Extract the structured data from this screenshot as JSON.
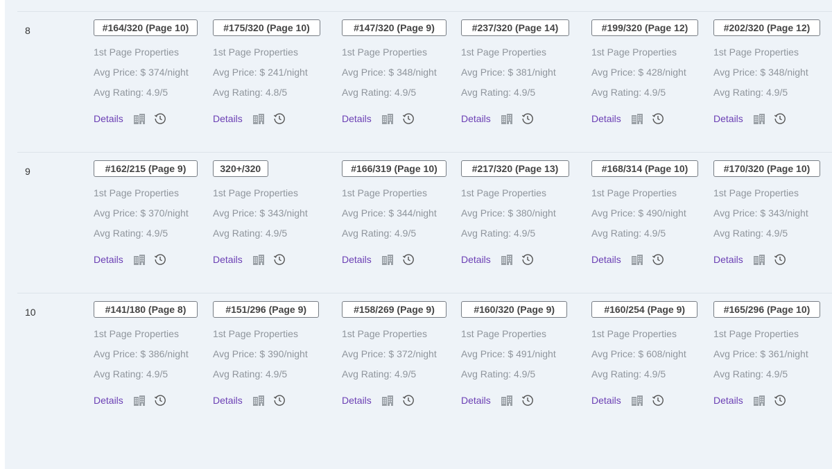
{
  "rows": [
    {
      "num": "8",
      "cells": [
        {
          "rank": "#164/320 (Page 10)",
          "properties": "1st Page Properties",
          "price": "Avg Price: $ 374/night",
          "rating": "Avg Rating: 4.9/5",
          "details": "Details"
        },
        {
          "rank": "#175/320 (Page 10)",
          "properties": "1st Page Properties",
          "price": "Avg Price: $ 241/night",
          "rating": "Avg Rating: 4.8/5",
          "details": "Details"
        },
        {
          "rank": "#147/320 (Page 9)",
          "properties": "1st Page Properties",
          "price": "Avg Price: $ 348/night",
          "rating": "Avg Rating: 4.9/5",
          "details": "Details"
        },
        {
          "rank": "#237/320 (Page 14)",
          "properties": "1st Page Properties",
          "price": "Avg Price: $ 381/night",
          "rating": "Avg Rating: 4.9/5",
          "details": "Details"
        },
        {
          "rank": "#199/320 (Page 12)",
          "properties": "1st Page Properties",
          "price": "Avg Price: $ 428/night",
          "rating": "Avg Rating: 4.9/5",
          "details": "Details"
        },
        {
          "rank": "#202/320 (Page 12)",
          "properties": "1st Page Properties",
          "price": "Avg Price: $ 348/night",
          "rating": "Avg Rating: 4.9/5",
          "details": "Details"
        }
      ]
    },
    {
      "num": "9",
      "cells": [
        {
          "rank": "#162/215 (Page 9)",
          "properties": "1st Page Properties",
          "price": "Avg Price: $ 370/night",
          "rating": "Avg Rating: 4.9/5",
          "details": "Details"
        },
        {
          "rank": "320+/320",
          "properties": "1st Page Properties",
          "price": "Avg Price: $ 343/night",
          "rating": "Avg Rating: 4.9/5",
          "details": "Details"
        },
        {
          "rank": "#166/319 (Page 10)",
          "properties": "1st Page Properties",
          "price": "Avg Price: $ 344/night",
          "rating": "Avg Rating: 4.9/5",
          "details": "Details"
        },
        {
          "rank": "#217/320 (Page 13)",
          "properties": "1st Page Properties",
          "price": "Avg Price: $ 380/night",
          "rating": "Avg Rating: 4.9/5",
          "details": "Details"
        },
        {
          "rank": "#168/314 (Page 10)",
          "properties": "1st Page Properties",
          "price": "Avg Price: $ 490/night",
          "rating": "Avg Rating: 4.9/5",
          "details": "Details"
        },
        {
          "rank": "#170/320 (Page 10)",
          "properties": "1st Page Properties",
          "price": "Avg Price: $ 343/night",
          "rating": "Avg Rating: 4.9/5",
          "details": "Details"
        }
      ]
    },
    {
      "num": "10",
      "cells": [
        {
          "rank": "#141/180 (Page 8)",
          "properties": "1st Page Properties",
          "price": "Avg Price: $ 386/night",
          "rating": "Avg Rating: 4.9/5",
          "details": "Details"
        },
        {
          "rank": "#151/296 (Page 9)",
          "properties": "1st Page Properties",
          "price": "Avg Price: $ 390/night",
          "rating": "Avg Rating: 4.9/5",
          "details": "Details"
        },
        {
          "rank": "#158/269 (Page 9)",
          "properties": "1st Page Properties",
          "price": "Avg Price: $ 372/night",
          "rating": "Avg Rating: 4.9/5",
          "details": "Details"
        },
        {
          "rank": "#160/320 (Page 9)",
          "properties": "1st Page Properties",
          "price": "Avg Price: $ 491/night",
          "rating": "Avg Rating: 4.9/5",
          "details": "Details"
        },
        {
          "rank": "#160/254 (Page 9)",
          "properties": "1st Page Properties",
          "price": "Avg Price: $ 608/night",
          "rating": "Avg Rating: 4.9/5",
          "details": "Details"
        },
        {
          "rank": "#165/296 (Page 10)",
          "properties": "1st Page Properties",
          "price": "Avg Price: $ 361/night",
          "rating": "Avg Rating: 4.9/5",
          "details": "Details"
        }
      ]
    }
  ],
  "icons": {
    "building": "building-icon",
    "clock": "history-clock-icon"
  },
  "colors": {
    "background": "#eef3f8",
    "link": "#6b3fb4",
    "muted_text": "#8f959c",
    "icon": "#9aa0a6"
  }
}
